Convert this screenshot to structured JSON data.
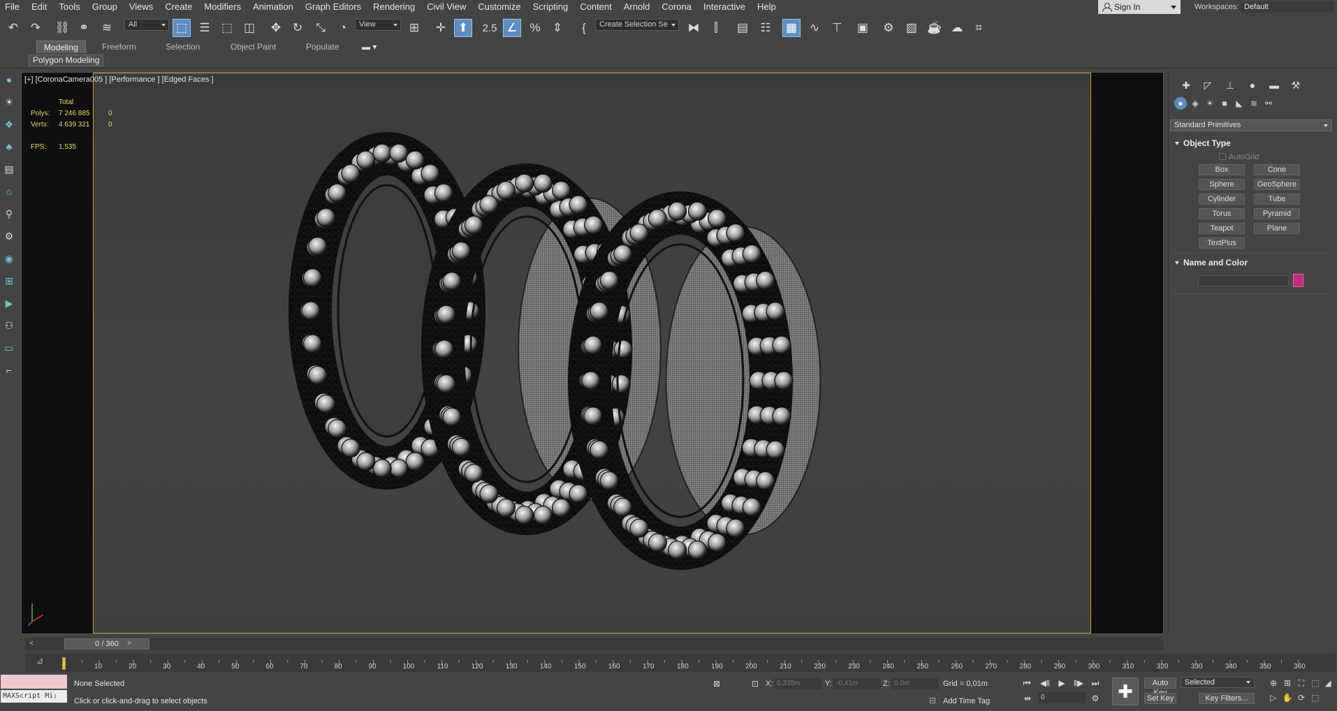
{
  "menu": [
    "File",
    "Edit",
    "Tools",
    "Group",
    "Views",
    "Create",
    "Modifiers",
    "Animation",
    "Graph Editors",
    "Rendering",
    "Civil View",
    "Customize",
    "Scripting",
    "Content",
    "Arnold",
    "Corona",
    "Interactive",
    "Help"
  ],
  "account": {
    "sign_in": "Sign In",
    "workspaces_label": "Workspaces:",
    "workspace": "Default"
  },
  "toolbar": {
    "filter": "All",
    "ref_coord": "View",
    "snap_angle": "2.5",
    "selection_set": "Create Selection Se"
  },
  "ribbon": {
    "tabs": [
      "Modeling",
      "Freeform",
      "Selection",
      "Object Paint",
      "Populate"
    ],
    "panel": "Polygon Modeling"
  },
  "viewport": {
    "label": "[+] [CoronaCamera005 ] [Performance ] [Edged Faces ]",
    "stats": {
      "total_header": "Total",
      "polys_label": "Polys:",
      "polys_value": "7 246 885",
      "polys_sel": "0",
      "verts_label": "Verts:",
      "verts_value": "4 639 321",
      "verts_sel": "0",
      "fps_label": "FPS:",
      "fps_value": "1,535"
    }
  },
  "command_panel": {
    "category": "Standard Primitives",
    "object_type_title": "Object Type",
    "autogrid": "AutoGrid",
    "primitives": [
      "Box",
      "Cone",
      "Sphere",
      "GeoSphere",
      "Cylinder",
      "Tube",
      "Torus",
      "Pyramid",
      "Teapot",
      "Plane",
      "TextPlus"
    ],
    "name_color_title": "Name and Color",
    "object_color": "#c8287f"
  },
  "timeline": {
    "slider_text": "0 / 360",
    "prev": "<",
    "next": ">",
    "ticks": [
      "10",
      "20",
      "30",
      "40",
      "50",
      "60",
      "70",
      "80",
      "90",
      "100",
      "110",
      "120",
      "130",
      "140",
      "150",
      "160",
      "170",
      "180",
      "190",
      "200",
      "210",
      "220",
      "230",
      "240",
      "250",
      "260",
      "270",
      "280",
      "290",
      "300",
      "310",
      "320",
      "330",
      "340",
      "350",
      "360"
    ],
    "current_frame": 0
  },
  "status": {
    "maxscript": "MAXScript Mi:",
    "selection": "None Selected",
    "prompt": "Click or click-and-drag to select objects",
    "x_label": "X:",
    "x_value": "0,335m",
    "y_label": "Y:",
    "y_value": "-0,41m",
    "z_label": "Z:",
    "z_value": "0,0m",
    "grid": "Grid = 0,01m",
    "add_time_tag": "Add Time Tag",
    "frame": "0",
    "auto_key": "Auto Key",
    "set_key": "Set Key",
    "key_mode": "Selected",
    "key_filters": "Key Filters..."
  }
}
